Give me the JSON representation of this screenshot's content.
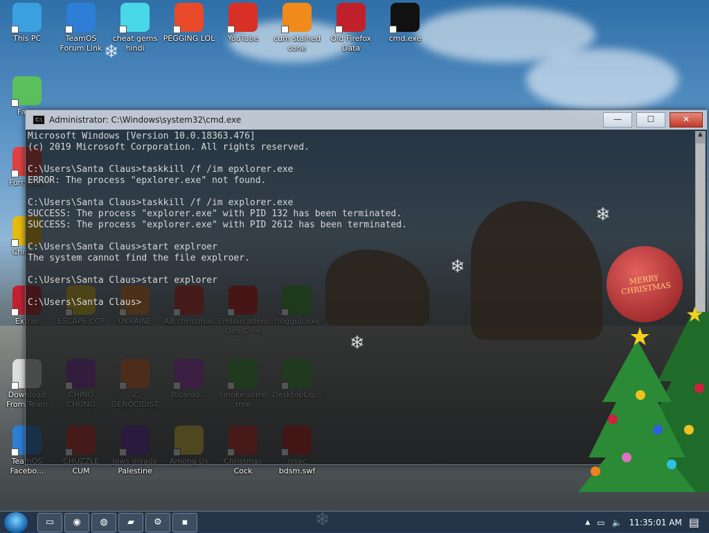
{
  "desktop_icons": [
    {
      "label": "This PC",
      "color": "#3aa0e0"
    },
    {
      "label": "TeamOS Forum Link",
      "color": "#2d7fd6"
    },
    {
      "label": "cheat gems hindi",
      "color": "#48d8e8"
    },
    {
      "label": "PEGGING LOL",
      "color": "#e84a2a"
    },
    {
      "label": "YouTube",
      "color": "#d93025"
    },
    {
      "label": "cum stained cone",
      "color": "#f08a1a"
    },
    {
      "label": "Old Firefox Data",
      "color": "#c0202a"
    },
    {
      "label": "cmd.exe",
      "color": "#111111"
    },
    {
      "label": "Falco",
      "color": "#5bbf5b"
    },
    {
      "label": "Furry Box",
      "color": "#e04040"
    },
    {
      "label": "Chrome",
      "color": "#e8b90e"
    },
    {
      "label": "Extras",
      "color": "#c02030"
    },
    {
      "label": "ESCAPE.CCP",
      "color": "#e0c020"
    },
    {
      "label": "UKRAINE",
      "color": "#e08030"
    },
    {
      "label": "AB christmas",
      "color": "#d03030"
    },
    {
      "label": "Embarcadero Dev-C++",
      "color": "#cc2020"
    },
    {
      "label": "froggull.exe",
      "color": "#3aa03a"
    },
    {
      "label": "Download From Team",
      "color": "#dddddd"
    },
    {
      "label": "CHING CHONG",
      "color": "#8a3ab0"
    },
    {
      "label": "Z GENOCIDIST",
      "color": "#e07030"
    },
    {
      "label": "Ricardo...",
      "color": "#a040c0"
    },
    {
      "label": "Smoke some tree",
      "color": "#40a040"
    },
    {
      "label": "DesktopLig...",
      "color": "#40a040"
    },
    {
      "label": "TeamOS Facebo...",
      "color": "#2d7fd6"
    },
    {
      "label": "CHUZZLE CUM",
      "color": "#d03030"
    },
    {
      "label": "Jews invade Palestine",
      "color": "#6a30b0"
    },
    {
      "label": "Among Us",
      "color": "#e8d040"
    },
    {
      "label": "Christmas Cock",
      "color": "#d03030"
    },
    {
      "label": "issac bdsm.swf",
      "color": "#c02020"
    }
  ],
  "cmd_window": {
    "title": "Administrator: C:\\Windows\\system32\\cmd.exe",
    "icon": "cmd-icon",
    "minimize": "—",
    "maximize": "☐",
    "close": "✕",
    "lines": [
      "Microsoft Windows [Version 10.0.18363.476]",
      "(c) 2019 Microsoft Corporation. All rights reserved.",
      "",
      "C:\\Users\\Santa Claus>taskkill /f /im epxlorer.exe",
      "ERROR: The process \"epxlorer.exe\" not found.",
      "",
      "C:\\Users\\Santa Claus>taskkill /f /im explorer.exe",
      "SUCCESS: The process \"explorer.exe\" with PID 132 has been terminated.",
      "SUCCESS: The process \"explorer.exe\" with PID 2612 has been terminated.",
      "",
      "C:\\Users\\Santa Claus>start explroer",
      "The system cannot find the file explroer.",
      "",
      "C:\\Users\\Santa Claus>start explorer",
      "",
      "C:\\Users\\Santa Claus>"
    ]
  },
  "taskbar": {
    "start": "start-orb-icon",
    "buttons": [
      {
        "name": "task-view-icon",
        "glyph": "▭"
      },
      {
        "name": "chrome-icon",
        "glyph": "◉"
      },
      {
        "name": "firefox-icon",
        "glyph": "◍"
      },
      {
        "name": "file-explorer-icon",
        "glyph": "▰"
      },
      {
        "name": "settings-icon",
        "glyph": "⚙"
      },
      {
        "name": "cmd-icon",
        "glyph": "▪"
      }
    ],
    "tray_arrow": "▲",
    "network": "▭",
    "volume": "🔈",
    "clock": "11:35:01 AM",
    "notifications": "▤"
  },
  "ornament_text": "MERRY CHRISTMAS"
}
